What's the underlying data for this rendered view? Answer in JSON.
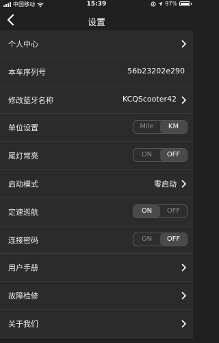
{
  "status": {
    "carrier": "中国移动",
    "time": "15:39",
    "battery": "97%",
    "battery_level": 0.97
  },
  "nav": {
    "title": "设置"
  },
  "rows": [
    {
      "label": "个人中心"
    },
    {
      "label": "本车序列号",
      "value": "56b23202e290"
    },
    {
      "label": "修改蓝牙名称",
      "value": "KCQScooter42"
    },
    {
      "label": "单位设置",
      "left": "Mile",
      "right": "KM",
      "active": "right"
    },
    {
      "label": "尾灯常亮",
      "left": "ON",
      "right": "OFF",
      "active": "right"
    },
    {
      "label": "启动模式",
      "value": "零启动"
    },
    {
      "label": "定速巡航",
      "left": "ON",
      "right": "OFF",
      "active": "left"
    },
    {
      "label": "连接密码",
      "left": "ON",
      "right": "OFF",
      "active": "right"
    },
    {
      "label": "用户手册"
    },
    {
      "label": "故障检修"
    },
    {
      "label": "关于我们"
    }
  ]
}
